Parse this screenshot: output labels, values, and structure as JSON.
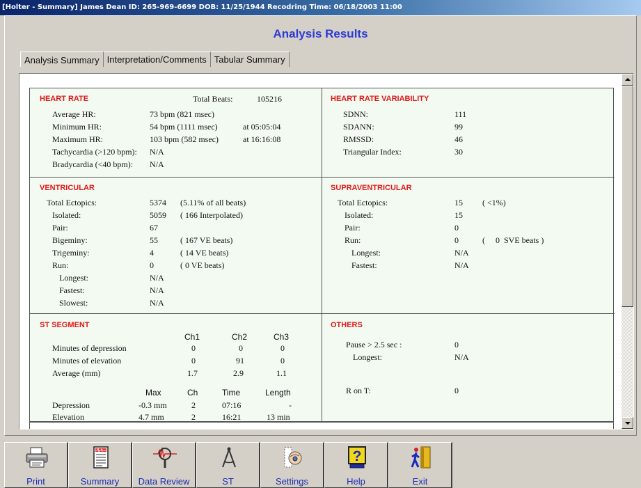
{
  "window": {
    "title": "[Holter - Summary]   James Dean  ID: 265-969-6699  DOB: 11/25/1944  Recodring Time: 06/18/2003 11:00"
  },
  "page_heading": "Analysis Results",
  "tabs": [
    {
      "label": "Analysis Summary",
      "active": true
    },
    {
      "label": "Interpretation/Comments",
      "active": false
    },
    {
      "label": "Tabular Summary",
      "active": false
    }
  ],
  "heart_rate": {
    "title": "HEART RATE",
    "total_beats_label": "Total Beats:",
    "total_beats_value": "105216",
    "rows": [
      {
        "label": "Average HR:",
        "value": "73  bpm (821 msec)",
        "time": ""
      },
      {
        "label": "Minimum  HR:",
        "value": "54  bpm (1111 msec)",
        "time": "at 05:05:04"
      },
      {
        "label": "Maximum  HR:",
        "value": "103 bpm (582 msec)",
        "time": "at 16:16:08"
      },
      {
        "label": "Tachycardia (>120 bpm):",
        "value": "N/A",
        "time": ""
      },
      {
        "label": "Bradycardia (<40 bpm):",
        "value": "N/A",
        "time": ""
      }
    ]
  },
  "hrv": {
    "title": "HEART RATE  VARIABILITY",
    "rows": [
      {
        "label": "SDNN:",
        "value": "111"
      },
      {
        "label": "SDANN:",
        "value": "99"
      },
      {
        "label": "RMSSD:",
        "value": "46"
      },
      {
        "label": "Triangular  Index:",
        "value": "30"
      }
    ]
  },
  "ventricular": {
    "title": "VENTRICULAR",
    "rows": [
      {
        "label": "Total  Ectopics:",
        "value": "5374",
        "note": "(5.11% of all beats)"
      },
      {
        "label": "Isolated:",
        "value": "5059",
        "note": "( 166  Interpolated)"
      },
      {
        "label": "Pair:",
        "value": "67",
        "note": ""
      },
      {
        "label": "Bigeminy:",
        "value": "55",
        "note": "( 167  VE beats)"
      },
      {
        "label": "Trigeminy:",
        "value": "4",
        "note": "(  14  VE beats)"
      },
      {
        "label": "Run:",
        "value": "0",
        "note": "(   0  VE beats)"
      },
      {
        "label": "Longest:",
        "value": "N/A",
        "note": ""
      },
      {
        "label": "Fastest:",
        "value": "N/A",
        "note": ""
      },
      {
        "label": "Slowest:",
        "value": "N/A",
        "note": ""
      }
    ]
  },
  "supraventricular": {
    "title": "SUPRAVENTRICULAR",
    "rows": [
      {
        "label": "Total  Ectopics:",
        "value": "15",
        "note": "( <1%)"
      },
      {
        "label": "Isolated:",
        "value": "15",
        "note": ""
      },
      {
        "label": "Pair:",
        "value": "0",
        "note": ""
      },
      {
        "label": "Run:",
        "value": "0",
        "note": "(     0  SVE beats )"
      },
      {
        "label": "Longest:",
        "value": "N/A",
        "note": ""
      },
      {
        "label": "Fastest:",
        "value": "N/A",
        "note": ""
      }
    ]
  },
  "st_segment": {
    "title": "ST  SEGMENT",
    "channel_headers": [
      "Ch1",
      "Ch2",
      "Ch3"
    ],
    "rows": [
      {
        "label": "Minutes of depression",
        "values": [
          "0",
          "0",
          "0"
        ]
      },
      {
        "label": "Minutes of elevation",
        "values": [
          "0",
          "91",
          "0"
        ]
      },
      {
        "label": "Average (mm)",
        "values": [
          "1.7",
          "2.9",
          "1.1"
        ]
      }
    ],
    "detail_headers": [
      "Max",
      "Ch",
      "Time",
      "Length"
    ],
    "detail_rows": [
      {
        "label": "Depression",
        "values": [
          "-0.3 mm",
          "2",
          "07:16",
          "-"
        ]
      },
      {
        "label": "Elevation",
        "values": [
          "4.7 mm",
          "2",
          "16:21",
          "13 min"
        ]
      }
    ]
  },
  "others": {
    "title": "OTHERS",
    "rows": [
      {
        "label": "Pause > 2.5 sec :",
        "value": "0"
      },
      {
        "label": "Longest:",
        "value": "N/A"
      },
      {
        "label": "R on T:",
        "value": "0"
      }
    ]
  },
  "toolbar": {
    "buttons": [
      {
        "label": "Print",
        "icon": "printer-icon"
      },
      {
        "label": "Summary",
        "icon": "summary-report-icon"
      },
      {
        "label": "Data Review",
        "icon": "magnifier-ecg-icon"
      },
      {
        "label": "ST",
        "icon": "compass-icon"
      },
      {
        "label": "Settings",
        "icon": "settings-hand-icon"
      },
      {
        "label": "Help",
        "icon": "help-question-icon"
      },
      {
        "label": "Exit",
        "icon": "exit-door-icon"
      }
    ]
  }
}
